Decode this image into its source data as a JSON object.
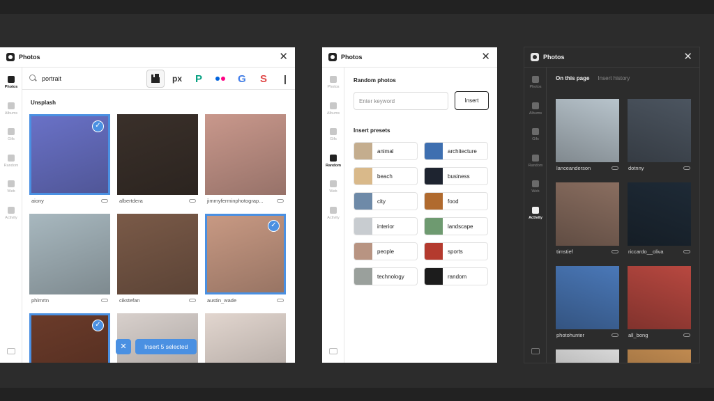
{
  "colors": {
    "accent": "#4a90e2",
    "dark_bg": "#2c2c2c",
    "light_bg": "#ffffff"
  },
  "panels": [
    {
      "theme": "light",
      "title": "Photos",
      "sidebar": [
        {
          "label": "Photos",
          "icon": "image-icon",
          "active": true
        },
        {
          "label": "Albums",
          "icon": "albums-icon",
          "active": false
        },
        {
          "label": "Gifs",
          "icon": "gif-icon",
          "active": false
        },
        {
          "label": "Random",
          "icon": "dice-icon",
          "active": false
        },
        {
          "label": "Web",
          "icon": "globe-icon",
          "active": false
        },
        {
          "label": "Activity",
          "icon": "folder-icon",
          "active": false
        }
      ]
    },
    {
      "theme": "light",
      "title": "Photos",
      "sidebar": [
        {
          "label": "Photos",
          "icon": "image-icon",
          "active": false
        },
        {
          "label": "Albums",
          "icon": "albums-icon",
          "active": false
        },
        {
          "label": "Gifs",
          "icon": "gif-icon",
          "active": false
        },
        {
          "label": "Random",
          "icon": "dice-icon",
          "active": true
        },
        {
          "label": "Web",
          "icon": "globe-icon",
          "active": false
        },
        {
          "label": "Activity",
          "icon": "folder-icon",
          "active": false
        }
      ]
    },
    {
      "theme": "dark",
      "title": "Photos",
      "sidebar": [
        {
          "label": "Photos",
          "icon": "image-icon",
          "active": false
        },
        {
          "label": "Albums",
          "icon": "albums-icon",
          "active": false
        },
        {
          "label": "Gifs",
          "icon": "gif-icon",
          "active": false
        },
        {
          "label": "Random",
          "icon": "dice-icon",
          "active": false
        },
        {
          "label": "Web",
          "icon": "globe-icon",
          "active": false
        },
        {
          "label": "Activity",
          "icon": "folder-icon",
          "active": true
        }
      ]
    }
  ],
  "search": {
    "value": "portrait",
    "sources": [
      "unsplash-icon",
      "500px-icon",
      "pexels-icon",
      "flickr-icon",
      "google-icon",
      "shutterstock-icon",
      "other-source-icon"
    ],
    "active_source": "unsplash-icon"
  },
  "unsplash": {
    "section_title": "Unsplash",
    "photos": [
      {
        "author": "aiony",
        "selected": true,
        "color": "#6a72c8"
      },
      {
        "author": "albertdera",
        "selected": false,
        "color": "#3a302a"
      },
      {
        "author": "jimmyferminphotograp...",
        "selected": false,
        "color": "#c9988c"
      },
      {
        "author": "phlmrtn",
        "selected": false,
        "color": "#a8b8bf"
      },
      {
        "author": "cikstefan",
        "selected": false,
        "color": "#7a5a48"
      },
      {
        "author": "austin_wade",
        "selected": true,
        "color": "#c99a84"
      },
      {
        "author": "",
        "selected": true,
        "color": "#6b3b2a"
      },
      {
        "author": "",
        "selected": false,
        "color": "#d8d0cc"
      },
      {
        "author": "",
        "selected": false,
        "color": "#e2d6cf"
      }
    ],
    "insert_label": "Insert 5 selected"
  },
  "random": {
    "heading": "Random photos",
    "keyword_placeholder": "Enter keyword",
    "insert_label": "Insert",
    "presets_heading": "Insert presets",
    "presets": [
      {
        "label": "animal",
        "color": "#c4ad8e"
      },
      {
        "label": "architecture",
        "color": "#3e6fb0"
      },
      {
        "label": "beach",
        "color": "#d9b98a"
      },
      {
        "label": "business",
        "color": "#1e2430"
      },
      {
        "label": "city",
        "color": "#6e8aa8"
      },
      {
        "label": "food",
        "color": "#b06a2e"
      },
      {
        "label": "interior",
        "color": "#c8ccd0"
      },
      {
        "label": "landscape",
        "color": "#6e9a70"
      },
      {
        "label": "people",
        "color": "#b89482"
      },
      {
        "label": "sports",
        "color": "#b43a2e"
      },
      {
        "label": "technology",
        "color": "#9aa09c"
      },
      {
        "label": "random",
        "color": "#1c1c1c"
      }
    ]
  },
  "activity": {
    "tabs": [
      {
        "label": "On this page",
        "active": true
      },
      {
        "label": "Insert history",
        "active": false
      }
    ],
    "photos": [
      {
        "author": "lanceanderson",
        "color": "#b8c4cc"
      },
      {
        "author": "dotnny",
        "color": "#4c5560"
      },
      {
        "author": "timstief",
        "color": "#8a6e60"
      },
      {
        "author": "riccardo__oliva",
        "color": "#1e2a36"
      },
      {
        "author": "photohunter",
        "color": "#4a78b8"
      },
      {
        "author": "all_bong",
        "color": "#b84840"
      },
      {
        "author": "",
        "color": "#d8d8d8"
      },
      {
        "author": "",
        "color": "#c08a50"
      }
    ]
  }
}
